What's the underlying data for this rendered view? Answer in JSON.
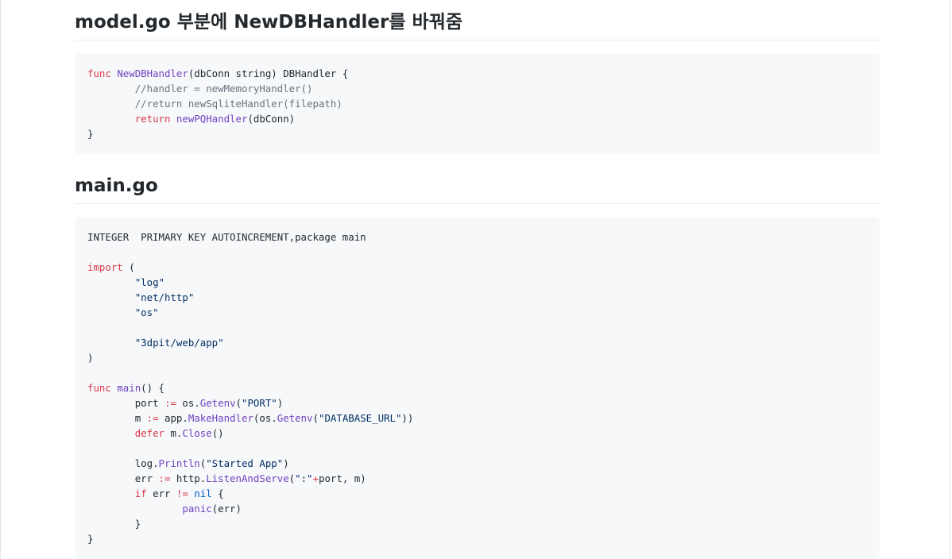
{
  "sections": [
    {
      "heading": "model.go 부분에 NewDBHandler를 바꿔줌",
      "code": {
        "l1": {
          "kw": "func",
          "fn": "NewDBHandler",
          "rest": "(dbConn string) DBHandler {"
        },
        "l2": {
          "indent": "        ",
          "comment": "//handler = newMemoryHandler()"
        },
        "l3": {
          "indent": "        ",
          "comment": "//return newSqliteHandler(filepath)"
        },
        "l4": {
          "indent": "        ",
          "kw": "return",
          "fn": "newPQHandler",
          "rest": "(dbConn)"
        },
        "l5": {
          "text": "}"
        }
      }
    },
    {
      "heading": "main.go",
      "code": {
        "l1": {
          "text": "INTEGER  PRIMARY KEY AUTOINCREMENT,package main"
        },
        "l3": {
          "kw": "import",
          "rest": " ("
        },
        "l4": {
          "indent": "        ",
          "str": "\"log\""
        },
        "l5": {
          "indent": "        ",
          "str": "\"net/http\""
        },
        "l6": {
          "indent": "        ",
          "str": "\"os\""
        },
        "l8": {
          "indent": "        ",
          "str": "\"3dpit/web/app\""
        },
        "l9": {
          "text": ")"
        },
        "l11": {
          "kw": "func",
          "fn": "main",
          "rest": "() {"
        },
        "l12": {
          "indent": "        ",
          "a": "port ",
          "op": ":=",
          "b": " os.",
          "fn": "Getenv",
          "c": "(",
          "str": "\"PORT\"",
          "d": ")"
        },
        "l13": {
          "indent": "        ",
          "a": "m ",
          "op": ":=",
          "b": " app.",
          "fn": "MakeHandler",
          "c": "(os.",
          "fn2": "Getenv",
          "d": "(",
          "str": "\"DATABASE_URL\"",
          "e": "))"
        },
        "l14": {
          "indent": "        ",
          "kw": "defer",
          "b": " m.",
          "fn": "Close",
          "c": "()"
        },
        "l16": {
          "indent": "        ",
          "a": "log.",
          "fn": "Println",
          "c": "(",
          "str": "\"Started App\"",
          "d": ")"
        },
        "l17": {
          "indent": "        ",
          "a": "err ",
          "op": ":=",
          "b": " http.",
          "fn": "ListenAndServe",
          "c": "(",
          "str": "\":\"",
          "op2": "+",
          "d": "port, m)"
        },
        "l18": {
          "indent": "        ",
          "kw": "if",
          "a": " err ",
          "op": "!=",
          "nl": " nil",
          "b": " {"
        },
        "l19": {
          "indent": "                ",
          "fn": "panic",
          "c": "(err)"
        },
        "l20": {
          "indent": "        ",
          "text": "}"
        },
        "l21": {
          "text": "}"
        }
      }
    }
  ],
  "colors": {
    "keyword": "#d73a49",
    "function": "#6f42c1",
    "comment": "#6a737d",
    "string": "#032f62",
    "code_bg": "#f6f8fa"
  }
}
